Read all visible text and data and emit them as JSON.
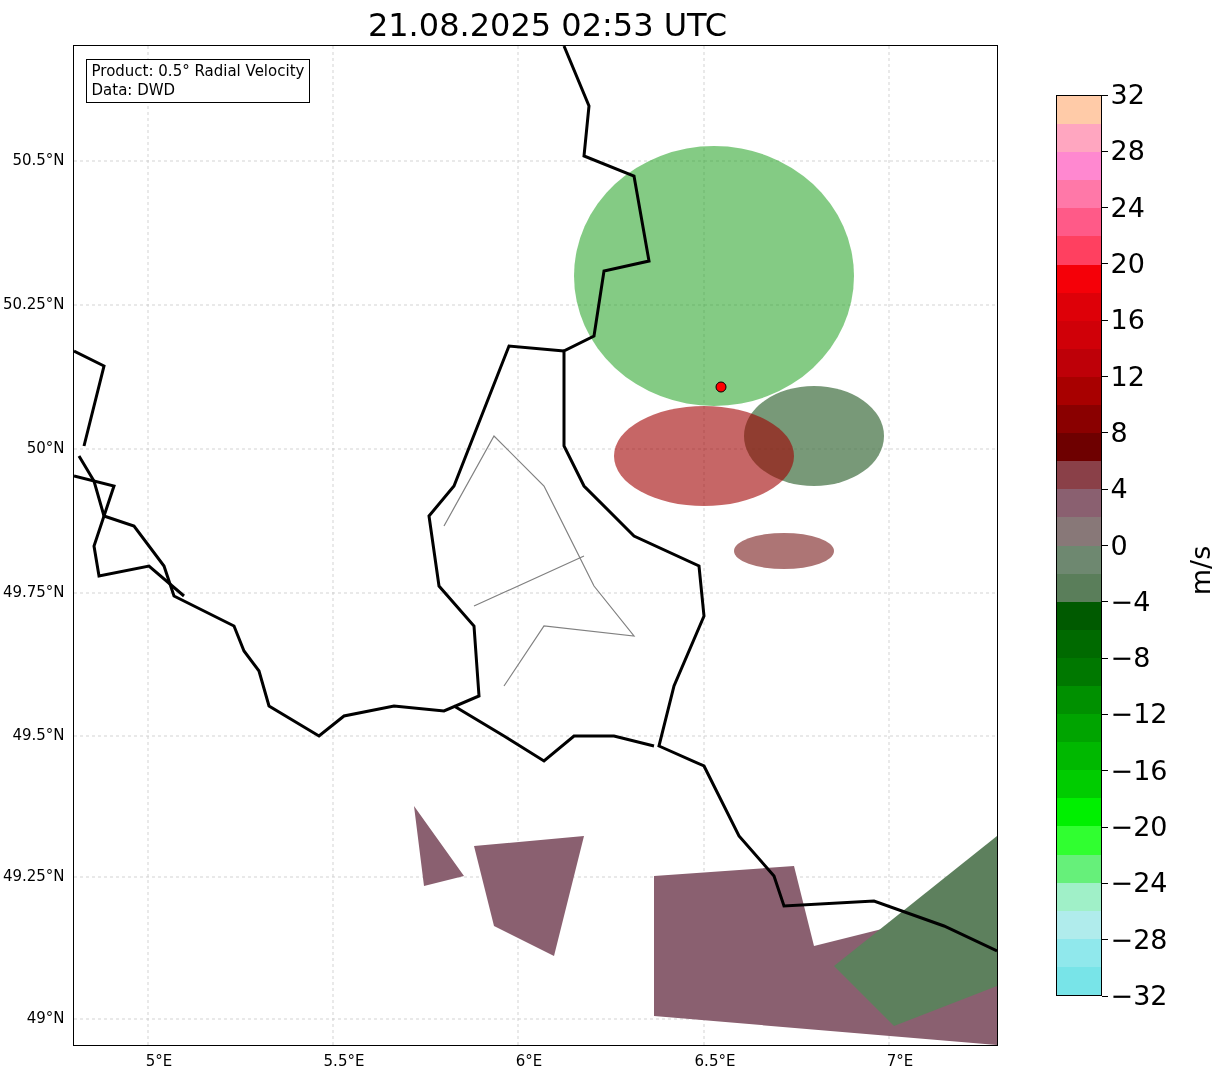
{
  "title": "21.08.2025 02:53 UTC",
  "map": {
    "info_box": [
      "Product: 0.5° Radial Velocity",
      "Data: DWD"
    ],
    "y_ticks": [
      "50.5°N",
      "50.25°N",
      "50°N",
      "49.75°N",
      "49.5°N",
      "49.25°N",
      "49°N"
    ],
    "x_ticks": [
      "5°E",
      "5.5°E",
      "6°E",
      "6.5°E",
      "7°E"
    ]
  },
  "colorbar": {
    "label": "m/s",
    "ticks": [
      "32",
      "28",
      "24",
      "20",
      "16",
      "12",
      "8",
      "4",
      "0",
      "−4",
      "−8",
      "−12",
      "−16",
      "−20",
      "−24",
      "−28",
      "−32"
    ],
    "bands": [
      {
        "color": "#ffcba8"
      },
      {
        "color": "#ffa6c0"
      },
      {
        "color": "#ff88d0"
      },
      {
        "color": "#ff78a8"
      },
      {
        "color": "#ff5a88"
      },
      {
        "color": "#ff4060"
      },
      {
        "color": "#f50008"
      },
      {
        "color": "#de0008"
      },
      {
        "color": "#d00008"
      },
      {
        "color": "#be0008"
      },
      {
        "color": "#a80000"
      },
      {
        "color": "#8a0000"
      },
      {
        "color": "#6e0000"
      },
      {
        "color": "#8a4048"
      },
      {
        "color": "#8a6070"
      },
      {
        "color": "#887878"
      },
      {
        "color": "#6e8870"
      },
      {
        "color": "#5a7e5a"
      },
      {
        "color": "#005a00"
      },
      {
        "color": "#006a00"
      },
      {
        "color": "#007800"
      },
      {
        "color": "#009000"
      },
      {
        "color": "#00a400"
      },
      {
        "color": "#00b800"
      },
      {
        "color": "#00cc00"
      },
      {
        "color": "#00f000"
      },
      {
        "color": "#30ff30"
      },
      {
        "color": "#66f07a"
      },
      {
        "color": "#a0f0c8"
      },
      {
        "color": "#b0ecec"
      },
      {
        "color": "#90e8ec"
      },
      {
        "color": "#78e4e8"
      }
    ]
  }
}
